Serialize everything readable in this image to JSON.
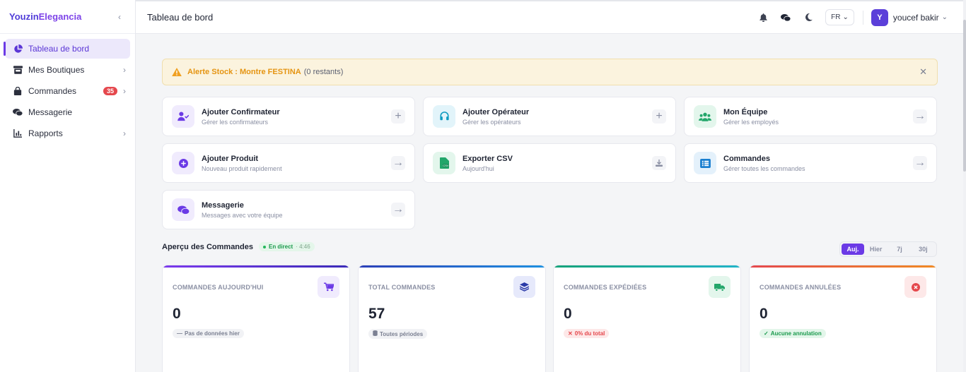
{
  "brand": {
    "part1": "Youzin",
    "part2": "Elegancia"
  },
  "colors": {
    "accent": "#6b3ae6",
    "alert_text": "#e59411",
    "badge": "#e5484d"
  },
  "sidebar": {
    "items": [
      {
        "label": "Tableau de bord",
        "icon": "dashboard-pie-icon",
        "active": true
      },
      {
        "label": "Mes Boutiques",
        "icon": "store-icon"
      },
      {
        "label": "Commandes",
        "icon": "shopping-bag-icon",
        "badge": "35"
      },
      {
        "label": "Messagerie",
        "icon": "chat-icon"
      },
      {
        "label": "Rapports",
        "icon": "bar-chart-icon"
      }
    ]
  },
  "header": {
    "title": "Tableau de bord",
    "lang": "FR",
    "user_initial": "Y",
    "user_name": "youcef bakir"
  },
  "alert": {
    "title": "Alerte Stock : Montre FESTINA",
    "count": "(0 restants)"
  },
  "quick_actions": [
    {
      "title": "Ajouter Confirmateur",
      "sub": "Gérer les confirmateurs",
      "icon": "user-check-icon",
      "action": "plus-icon"
    },
    {
      "title": "Ajouter Opérateur",
      "sub": "Gérer les opérateurs",
      "icon": "headset-icon",
      "action": "plus-icon"
    },
    {
      "title": "Mon Équipe",
      "sub": "Gérer les employés",
      "icon": "users-icon",
      "action": "arrow-right-icon"
    },
    {
      "title": "Ajouter Produit",
      "sub": "Nouveau produit rapidement",
      "icon": "plus-circle-icon",
      "action": "arrow-right-icon"
    },
    {
      "title": "Exporter CSV",
      "sub": "Aujourd'hui",
      "icon": "csv-file-icon",
      "action": "download-icon"
    },
    {
      "title": "Commandes",
      "sub": "Gérer toutes les commandes",
      "icon": "list-icon",
      "action": "arrow-right-icon"
    },
    {
      "title": "Messagerie",
      "sub": "Messages avec votre équipe",
      "icon": "chat-icon",
      "action": "arrow-right-icon"
    }
  ],
  "overview": {
    "title": "Aperçu des Commandes",
    "live": "En direct",
    "time": "· 4:46",
    "periods": [
      "Auj.",
      "Hier",
      "7j",
      "30j"
    ],
    "active_period": "Auj."
  },
  "stats": [
    {
      "label": "COMMANDES AUJOURD'HUI",
      "value": "0",
      "badge": "Pas de données hier",
      "icon": "cart-icon"
    },
    {
      "label": "TOTAL COMMANDES",
      "value": "57",
      "badge": "Toutes périodes",
      "icon": "layers-icon"
    },
    {
      "label": "COMMANDES EXPÉDIÉES",
      "value": "0",
      "badge": "0% du total",
      "icon": "truck-icon"
    },
    {
      "label": "COMMANDES ANNULÉES",
      "value": "0",
      "badge": "Aucune annulation",
      "icon": "cancel-circle-icon"
    }
  ]
}
